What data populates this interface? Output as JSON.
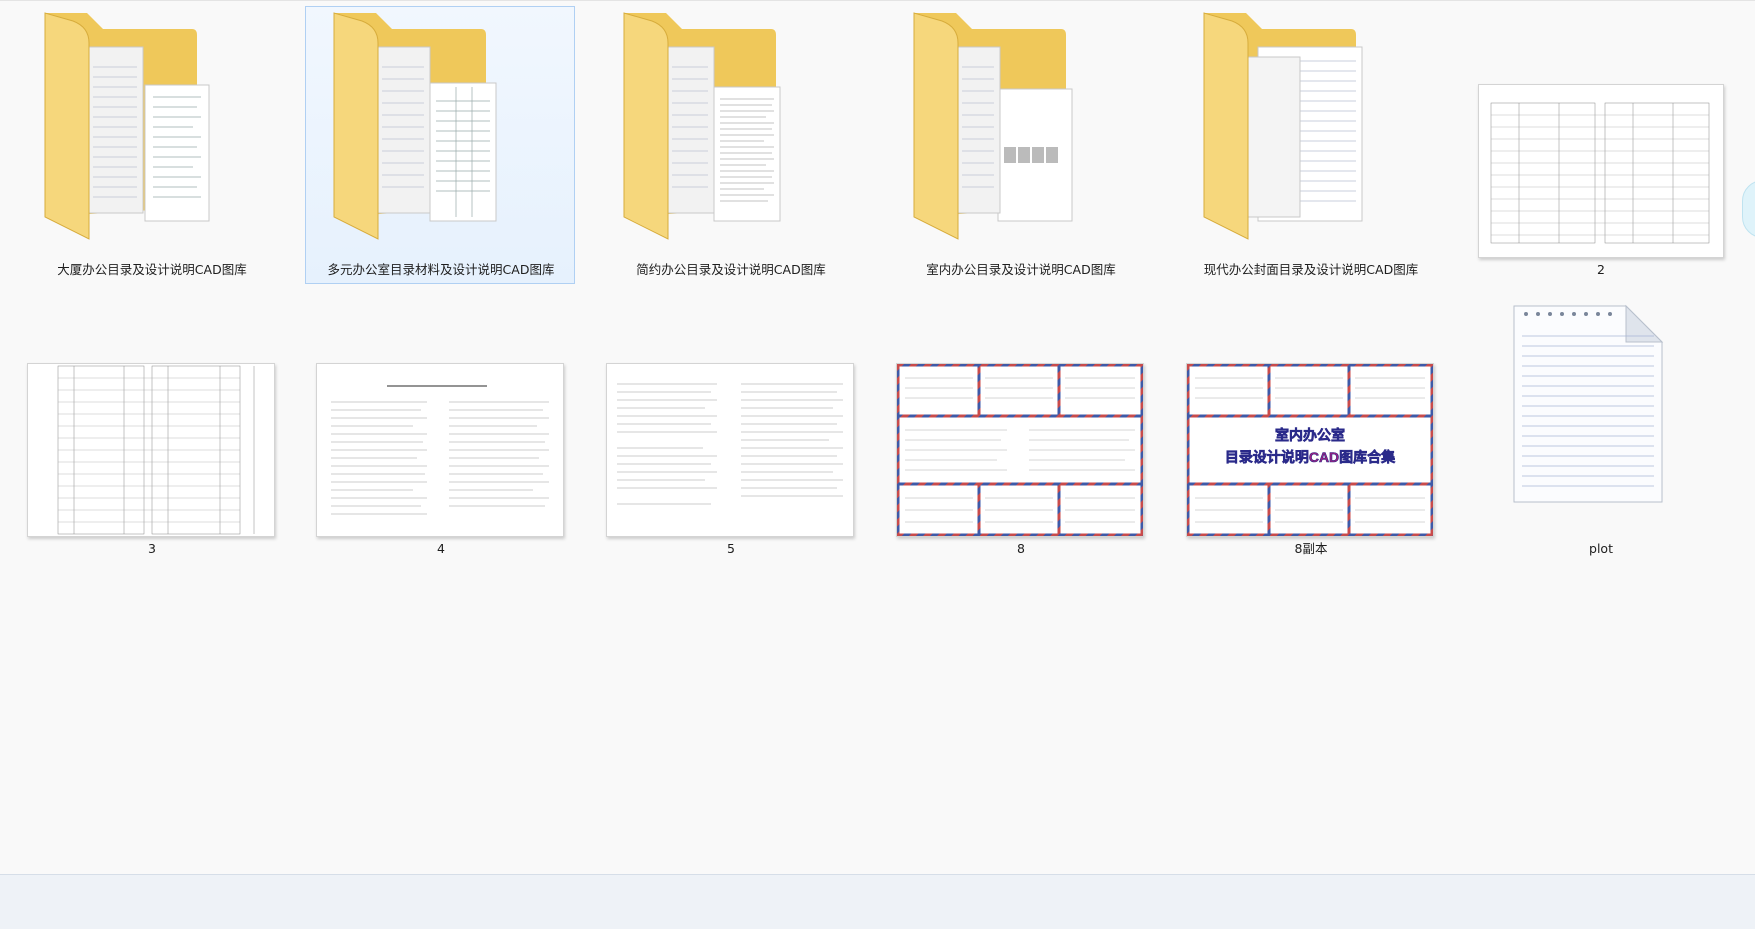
{
  "files": [
    {
      "name": "大厦办公目录及设计说明CAD图库",
      "type": "folder"
    },
    {
      "name": "多元办公室目录材料及设计说明CAD图库",
      "type": "folder",
      "selected": true
    },
    {
      "name": "简约办公目录及设计说明CAD图库",
      "type": "folder"
    },
    {
      "name": "室内办公目录及设计说明CAD图库",
      "type": "folder"
    },
    {
      "name": "现代办公封面目录及设计说明CAD图库",
      "type": "folder"
    },
    {
      "name": "2",
      "type": "image"
    },
    {
      "name": "3",
      "type": "image"
    },
    {
      "name": "4",
      "type": "image"
    },
    {
      "name": "5",
      "type": "image"
    },
    {
      "name": "8",
      "type": "image"
    },
    {
      "name": "8副本",
      "type": "image"
    },
    {
      "name": "plot",
      "type": "document"
    }
  ],
  "thumbnail_overlay": {
    "line1": "室内办公室",
    "line2": "目录设计说明CAD图库合集"
  }
}
